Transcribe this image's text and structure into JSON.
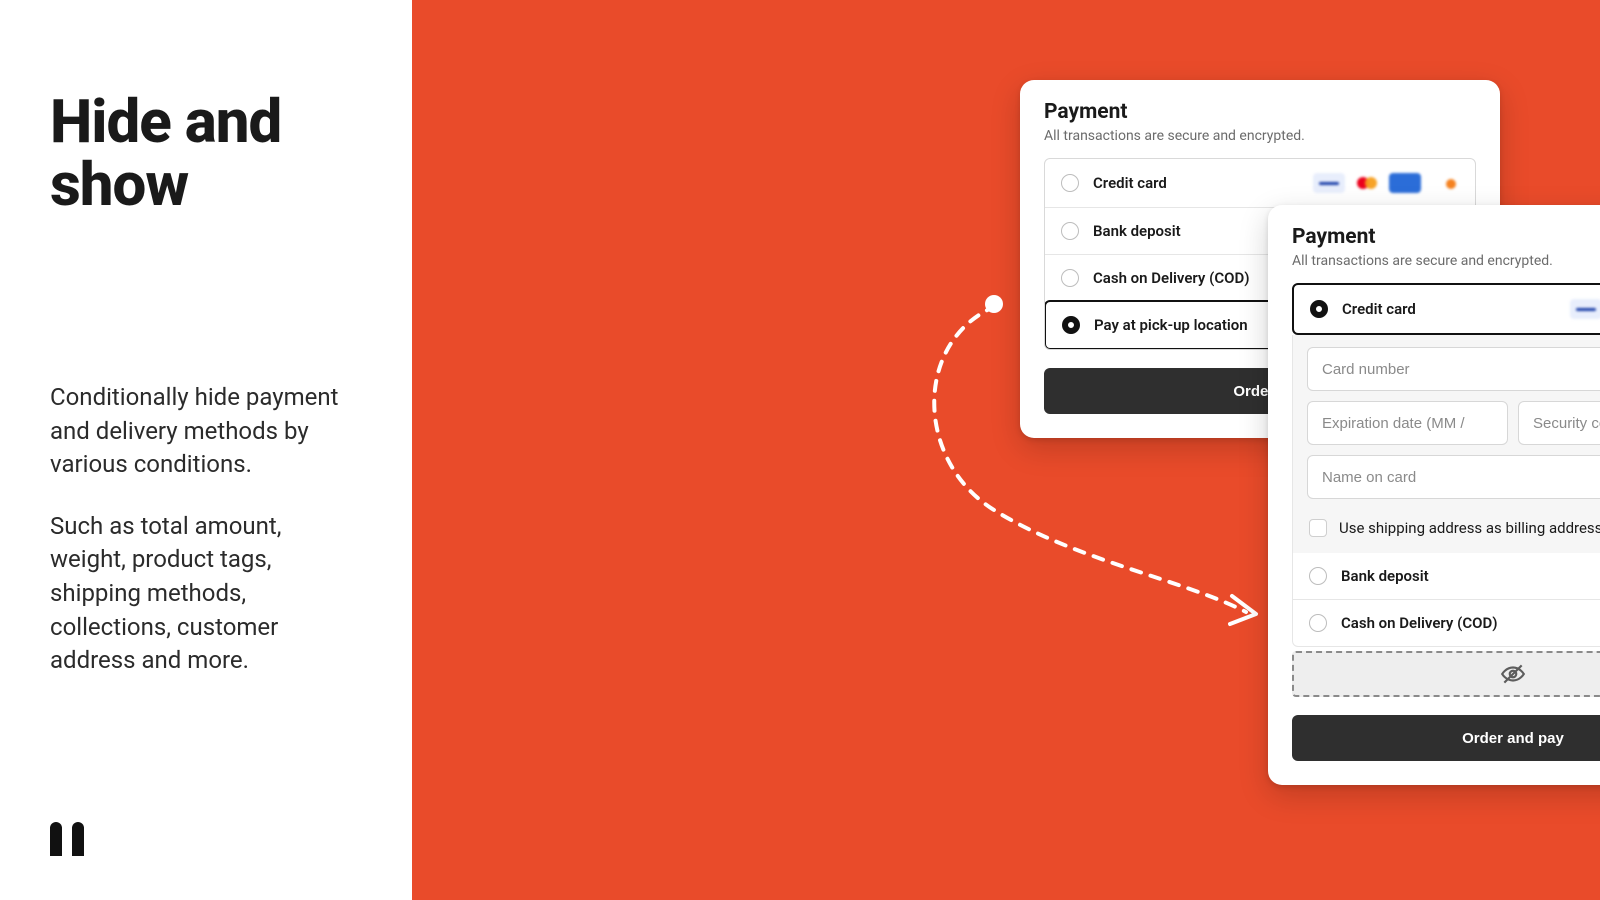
{
  "hero": {
    "title": "Hide and show",
    "p1": "Conditionally hide payment and delivery methods by various conditions.",
    "p2": "Such as total amount, weight, product tags, shipping methods, collections, customer address and more."
  },
  "card_a": {
    "title": "Payment",
    "subtitle": "All transactions are secure and encrypted.",
    "options": {
      "credit_card": "Credit card",
      "bank_deposit": "Bank deposit",
      "cod": "Cash on Delivery (COD)",
      "pickup": "Pay at pick-up location"
    },
    "button_label_cut": "Order a"
  },
  "card_b": {
    "title": "Payment",
    "subtitle": "All transactions are secure and encrypted.",
    "credit_card": "Credit card",
    "placeholders": {
      "card_number": "Card number",
      "exp": "Expiration date (MM / YY)",
      "cvv": "Security code",
      "name": "Name on card"
    },
    "shipping_as_billing": "Use shipping address as billing address",
    "bank_deposit": "Bank deposit",
    "cod": "Cash on Delivery (COD)",
    "order_button": "Order and pay"
  }
}
